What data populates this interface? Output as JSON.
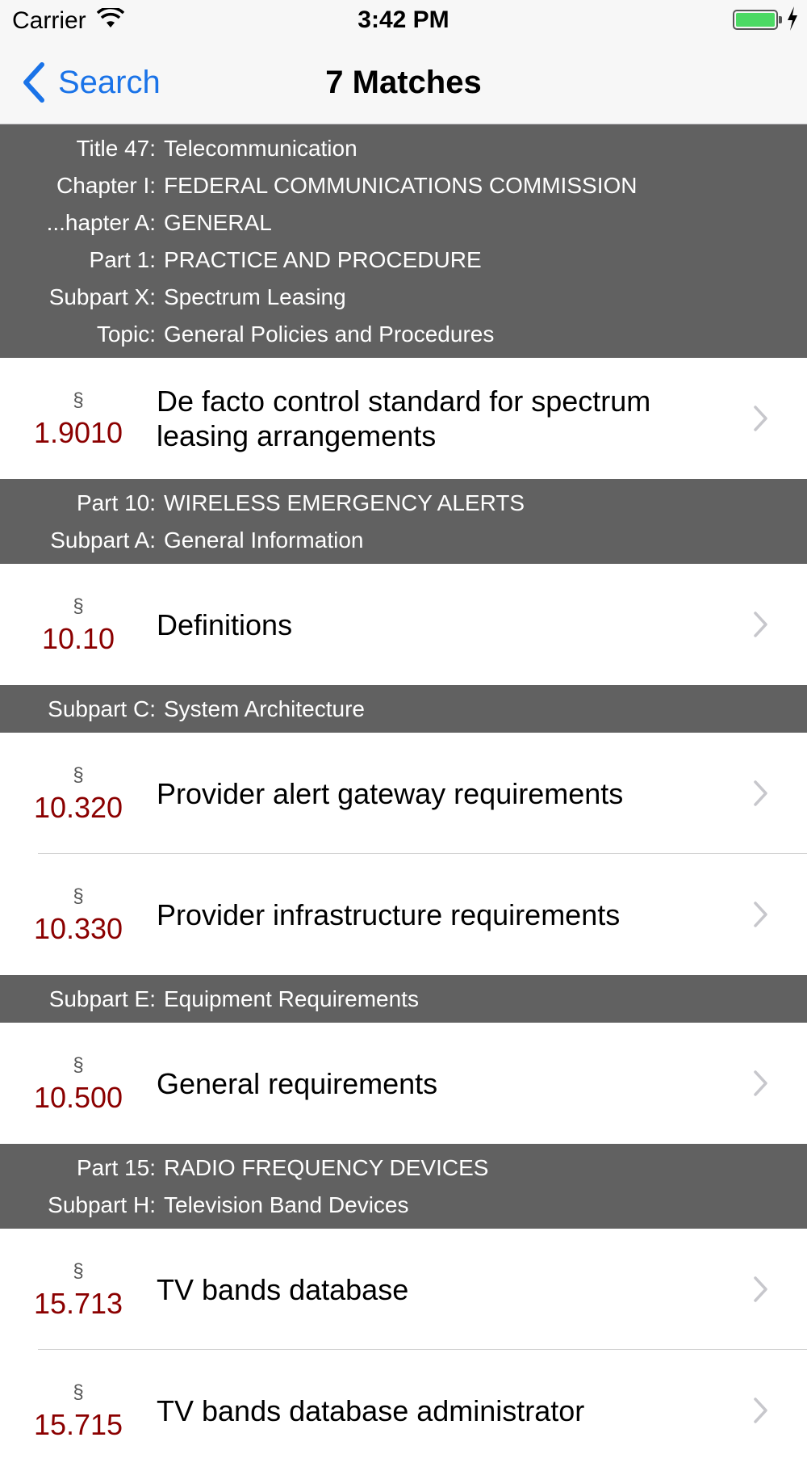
{
  "status": {
    "carrier": "Carrier",
    "time": "3:42 PM"
  },
  "nav": {
    "back_label": "Search",
    "title": "7 Matches"
  },
  "sections": [
    {
      "headers": [
        {
          "label": "Title 47:",
          "value": "Telecommunication"
        },
        {
          "label": "Chapter I:",
          "value": "FEDERAL COMMUNICATIONS COMMISSION"
        },
        {
          "label": "...hapter A:",
          "value": "GENERAL"
        },
        {
          "label": "Part 1:",
          "value": "PRACTICE AND PROCEDURE"
        },
        {
          "label": "Subpart X:",
          "value": "Spectrum Leasing"
        },
        {
          "label": "Topic:",
          "value": "General Policies and Procedures"
        }
      ],
      "rows": [
        {
          "symbol": "§",
          "number": "1.9010",
          "title": "De facto control standard for spectrum leasing arrangements"
        }
      ]
    },
    {
      "headers": [
        {
          "label": "Part 10:",
          "value": "WIRELESS EMERGENCY ALERTS"
        },
        {
          "label": "Subpart A:",
          "value": "General Information"
        }
      ],
      "rows": [
        {
          "symbol": "§",
          "number": "10.10",
          "title": "Definitions"
        }
      ]
    },
    {
      "headers": [
        {
          "label": "Subpart C:",
          "value": "System Architecture"
        }
      ],
      "rows": [
        {
          "symbol": "§",
          "number": "10.320",
          "title": "Provider alert gateway requirements"
        },
        {
          "symbol": "§",
          "number": "10.330",
          "title": "Provider infrastructure requirements"
        }
      ]
    },
    {
      "headers": [
        {
          "label": "Subpart E:",
          "value": "Equipment Requirements"
        }
      ],
      "rows": [
        {
          "symbol": "§",
          "number": "10.500",
          "title": "General requirements"
        }
      ]
    },
    {
      "headers": [
        {
          "label": "Part 15:",
          "value": "RADIO FREQUENCY DEVICES"
        },
        {
          "label": "Subpart H:",
          "value": "Television Band Devices"
        }
      ],
      "rows": [
        {
          "symbol": "§",
          "number": "15.713",
          "title": "TV bands database"
        },
        {
          "symbol": "§",
          "number": "15.715",
          "title": "TV bands database administrator"
        }
      ]
    }
  ],
  "colors": {
    "accent": "#1a73e8",
    "section_number": "#8b0000",
    "header_bg": "#616161"
  }
}
